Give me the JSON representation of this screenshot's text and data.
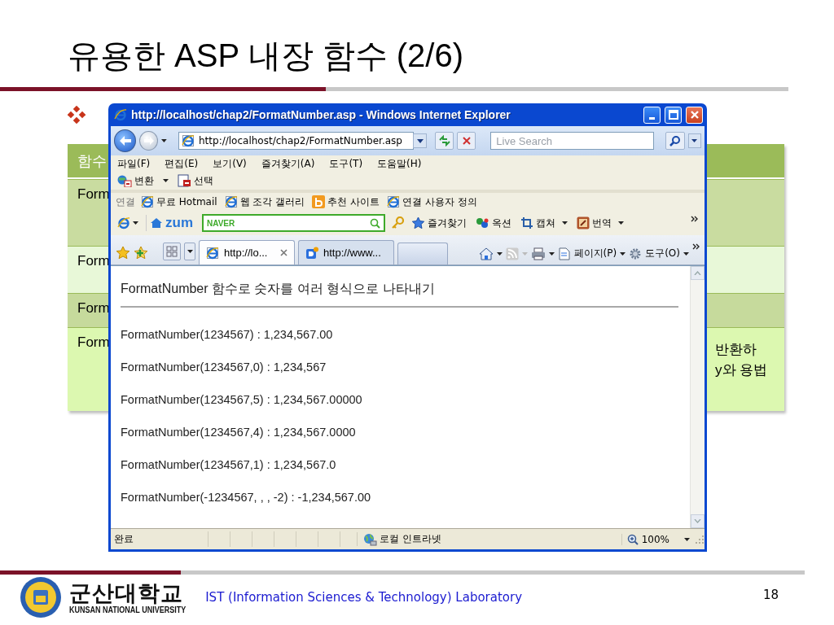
{
  "slide": {
    "title": "유용한 ASP 내장 함수 (2/6)"
  },
  "table": {
    "header": "함수",
    "rows": [
      {
        "cells": [
          "Form"
        ]
      },
      {
        "cells": [
          "Form"
        ]
      },
      {
        "cells": [
          "Form"
        ]
      },
      {
        "cells": [
          "Form"
        ],
        "right_lines": [
          "반환하",
          "y와 용법"
        ]
      }
    ]
  },
  "browser": {
    "title": "http://localhost/chap2/FormatNumber.asp - Windows Internet Explorer",
    "address": "http://localhost/chap2/FormatNumber.asp",
    "search_placeholder": "Live Search",
    "menu": [
      "파일(F)",
      "편집(E)",
      "보기(V)",
      "즐겨찾기(A)",
      "도구(T)",
      "도움말(H)"
    ],
    "command_bar": [
      {
        "label": "변환",
        "kind": "convert"
      },
      {
        "label": "선택",
        "kind": "select"
      }
    ],
    "links_label": "연결",
    "links": [
      {
        "label": "무료 Hotmail",
        "kind": "ie"
      },
      {
        "label": "웹 조각 갤러리",
        "kind": "ie"
      },
      {
        "label": "추천 사이트",
        "kind": "bing"
      },
      {
        "label": "연결 사용자 정의",
        "kind": "ie"
      }
    ],
    "toolbar_logo": "zum",
    "toolbar_search_label": "NAVER",
    "toolbar_items": [
      {
        "label": "즐겨찾기",
        "kind": "star",
        "dropdown": false
      },
      {
        "label": "옥션",
        "kind": "dots",
        "dropdown": false
      },
      {
        "label": "캡쳐",
        "kind": "capture",
        "dropdown": true
      },
      {
        "label": "번역",
        "kind": "translate",
        "dropdown": true
      }
    ],
    "tabs": [
      {
        "label": "http://lo...",
        "kind": "ie",
        "selected": true
      },
      {
        "label": "http://www...",
        "kind": "doc",
        "selected": false
      }
    ],
    "command_items": [
      {
        "label": "페이지(P)",
        "kind": "page"
      },
      {
        "label": "도구(O)",
        "kind": "gear"
      }
    ],
    "page": {
      "heading": "FormatNumber 함수로 숫자를 여러 형식으로 나타내기",
      "lines": [
        "FormatNumber(1234567) : 1,234,567.00",
        "FormatNumber(1234567,0) : 1,234,567",
        "FormatNumber(1234567,5) : 1,234,567.00000",
        "FormatNumber(1234567,4) : 1,234,567.0000",
        "FormatNumber(1234567,1) : 1,234,567.0",
        "FormatNumber(-1234567, , , -2) : -1,234,567.00"
      ]
    },
    "status": {
      "text": "완료",
      "zone": "로컬 인트라넷",
      "zoom": "100%"
    }
  },
  "footer": {
    "university": "군산대학교",
    "university_en": "KUNSAN NATIONAL UNIVERSITY",
    "lab": "IST (Information Sciences & Technology) Laboratory",
    "page_number": "18"
  }
}
